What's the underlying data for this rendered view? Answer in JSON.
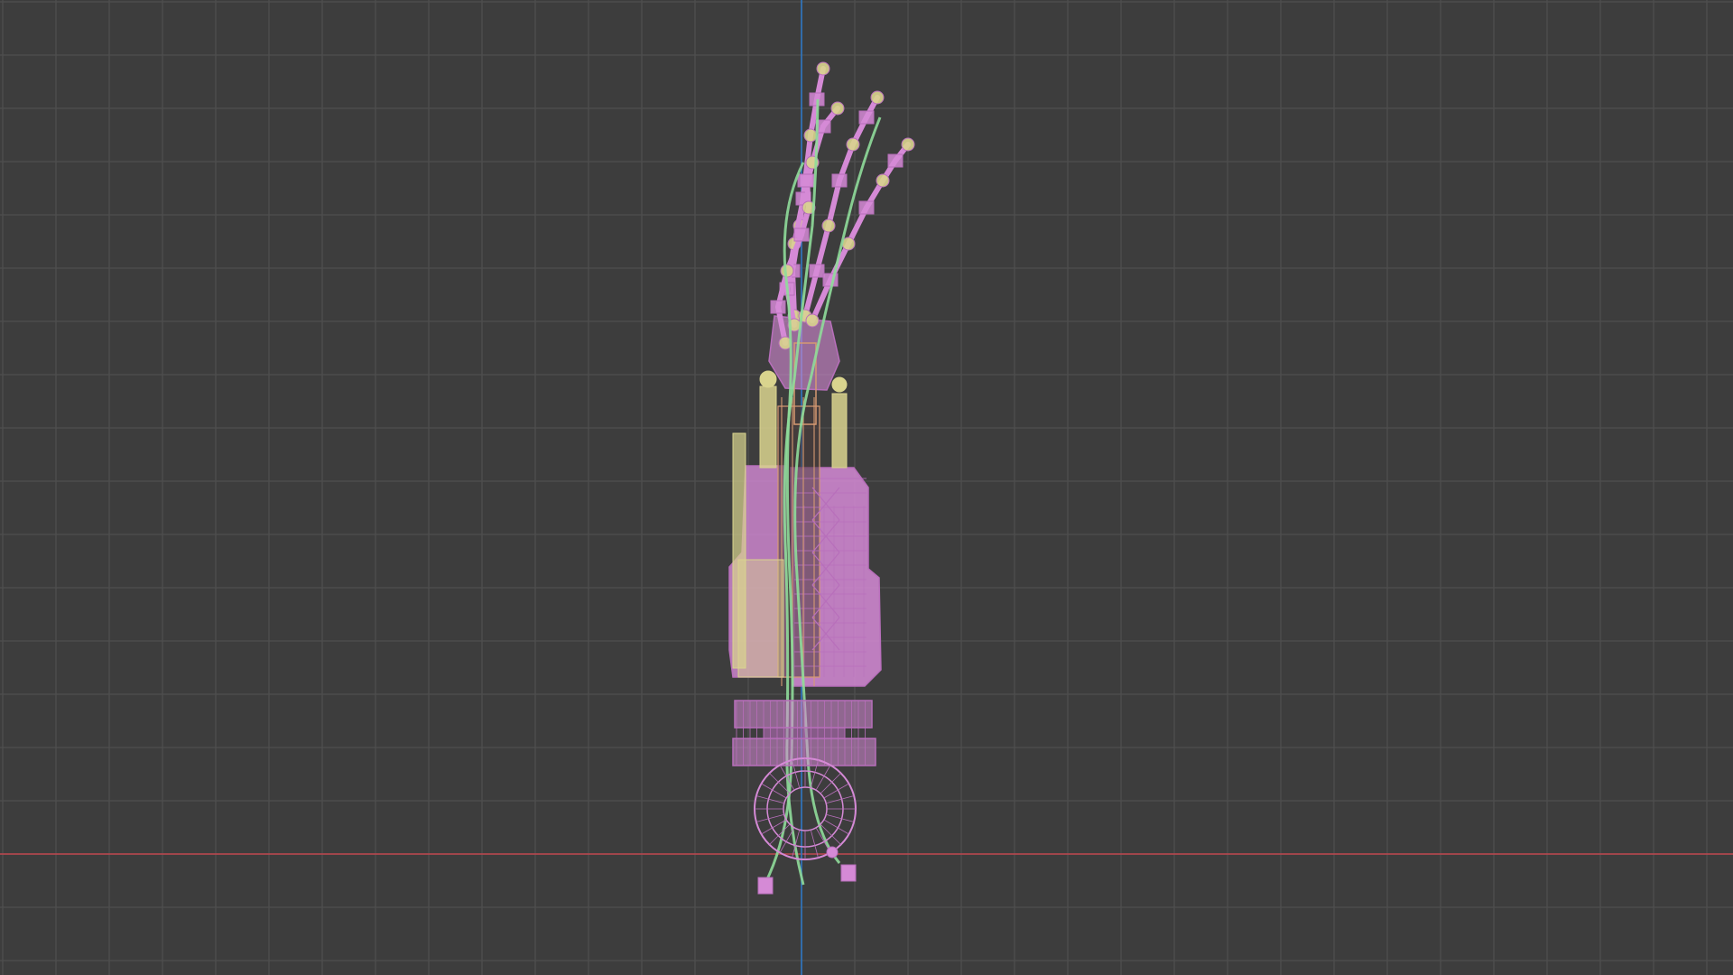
{
  "viewport": {
    "background_color": "#3d3d3d",
    "grid_color": "#4f4f4f",
    "x_axis_color": "#c0474f",
    "y_axis_color": "#2e78c4"
  },
  "model": {
    "name_icon": "robotic-arm-wireframe-icon",
    "colors": {
      "pink": "#d58ad6",
      "pink_dark": "#b86fbb",
      "yellow": "#d9d48e",
      "green": "#8fdc9a",
      "orange": "#d69a72"
    }
  }
}
